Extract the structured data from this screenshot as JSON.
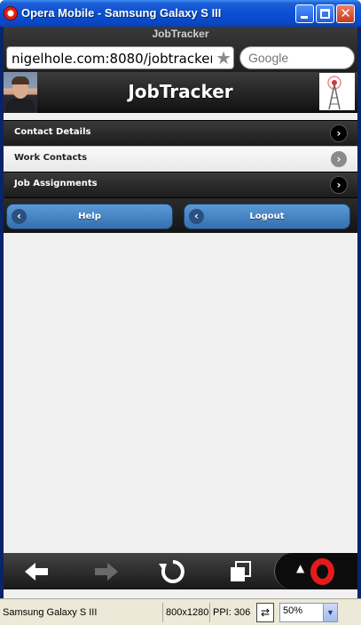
{
  "window": {
    "title": "Opera Mobile - Samsung Galaxy S III"
  },
  "browser": {
    "page_title": "JobTracker",
    "url": "nigelhole.com:8080/jobtracker/secu",
    "search_placeholder": "Google"
  },
  "page": {
    "heading": "JobTracker",
    "menu": [
      {
        "label": "Contact Details",
        "icon": "arrow-right-icon"
      },
      {
        "label": "Work Contacts",
        "icon": "arrow-right-icon"
      },
      {
        "label": "Job Assignments",
        "icon": "arrow-right-icon"
      }
    ],
    "buttons": {
      "help": "Help",
      "logout": "Logout"
    }
  },
  "toolbar": {
    "icons": [
      "back-arrow-icon",
      "forward-arrow-icon",
      "reload-icon",
      "tabs-icon",
      "opera-menu-icon"
    ]
  },
  "statusbar": {
    "device": "Samsung Galaxy S III",
    "resolution": "800x1280",
    "ppi": "PPI: 306",
    "zoom": "50%"
  },
  "colors": {
    "titlebar": "#0a4fd0",
    "button_blue": "#4a86c6",
    "opera_red": "#e21c1c"
  }
}
